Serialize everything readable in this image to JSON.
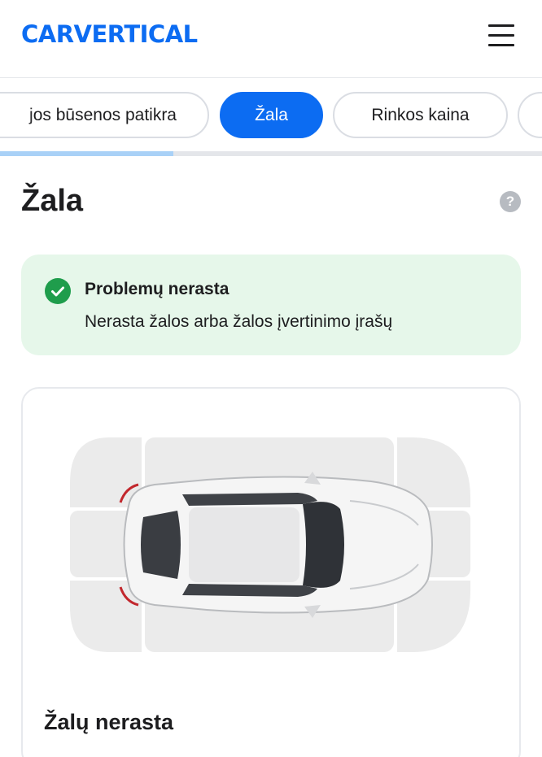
{
  "header": {
    "logo_text": "CARVERTICAL",
    "brand_color": "#0c6cf2",
    "menu_icon": "hamburger-menu-icon"
  },
  "tabs": [
    {
      "label": "jos būsenos patikra",
      "active": false
    },
    {
      "label": "Žala",
      "active": true
    },
    {
      "label": "Rinkos kaina",
      "active": false
    }
  ],
  "tab_progress": 0.32,
  "section": {
    "title": "Žala",
    "help_icon": "help-question-icon",
    "help_glyph": "?"
  },
  "alert": {
    "icon": "check-circle-icon",
    "title": "Problemų nerasta",
    "text": "Nerasta žalos arba žalos įvertinimo įrašų",
    "background": "#e6f7ea",
    "icon_color": "#1f9d4c"
  },
  "damage_card": {
    "diagram": "car-top-view-diagram",
    "title": "Žalų nerasta"
  }
}
